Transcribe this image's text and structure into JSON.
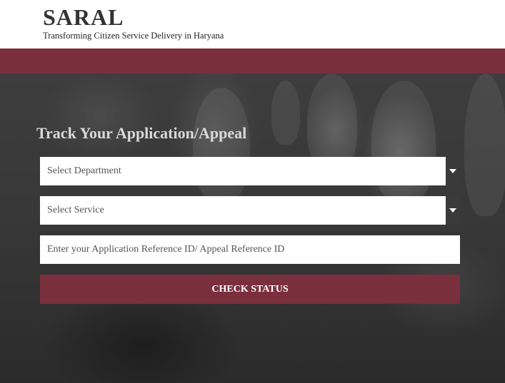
{
  "header": {
    "brand": "SARAL",
    "tagline": "Transforming Citizen Service Delivery in Haryana"
  },
  "form": {
    "title": "Track Your Application/Appeal",
    "department_select": {
      "value": "Select Department"
    },
    "service_select": {
      "value": "Select Service"
    },
    "reference_input": {
      "placeholder": "Enter your Application Reference ID/ Appeal Reference ID",
      "value": ""
    },
    "submit_label": "CHECK STATUS"
  },
  "colors": {
    "brand_band": "#7a2f3d",
    "button": "#7a2f3d",
    "header_text": "#333333"
  },
  "icons": {
    "dropdown": "caret-down-icon"
  }
}
